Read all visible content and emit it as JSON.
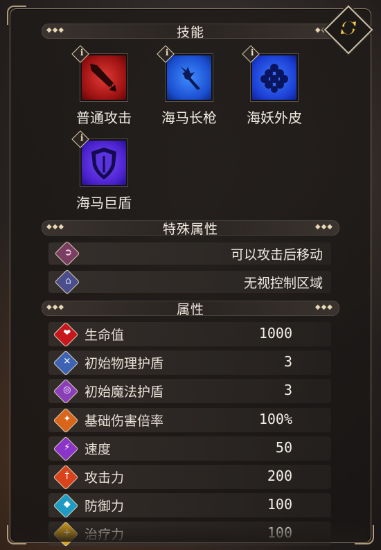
{
  "sections": {
    "skills_title": "技能",
    "special_title": "特殊属性",
    "attributes_title": "属性",
    "dots": "◆◆◆"
  },
  "skills": [
    {
      "name": "普通攻击",
      "info": "i",
      "color": "#c41f1f",
      "icon": "sword-icon"
    },
    {
      "name": "海马长枪",
      "info": "i",
      "color": "#1d5fe0",
      "icon": "trident-icon"
    },
    {
      "name": "海妖外皮",
      "info": "i",
      "color": "#2a4fe3",
      "icon": "scale-armor-icon"
    },
    {
      "name": "海马巨盾",
      "info": "i",
      "color": "#5a2fd6",
      "icon": "shield-icon"
    }
  ],
  "special": [
    {
      "text": "可以攻击后移动",
      "color": "#7a3e62",
      "icon": "move-after-attack-icon"
    },
    {
      "text": "无视控制区域",
      "color": "#4a4f8c",
      "icon": "ignore-zone-icon"
    }
  ],
  "attributes": [
    {
      "label": "生命值",
      "value": "1000",
      "color": "#c8161d",
      "icon": "heart-icon",
      "glyph": "❤"
    },
    {
      "label": "初始物理护盾",
      "value": "3",
      "color": "#3d63b5",
      "icon": "physical-shield-icon",
      "glyph": "✕"
    },
    {
      "label": "初始魔法护盾",
      "value": "3",
      "color": "#8a3fb8",
      "icon": "magic-shield-icon",
      "glyph": "◎"
    },
    {
      "label": "基础伤害倍率",
      "value": "100%",
      "color": "#d9651b",
      "icon": "damage-multiplier-icon",
      "glyph": "✦"
    },
    {
      "label": "速度",
      "value": "50",
      "color": "#8b34c9",
      "icon": "speed-icon",
      "glyph": "⚡"
    },
    {
      "label": "攻击力",
      "value": "200",
      "color": "#d8431c",
      "icon": "attack-icon",
      "glyph": "†"
    },
    {
      "label": "防御力",
      "value": "100",
      "color": "#1e9bc4",
      "icon": "defense-icon",
      "glyph": "◆"
    },
    {
      "label": "治疗力",
      "value": "100",
      "color": "#d9a21b",
      "icon": "heal-icon",
      "glyph": "+"
    }
  ]
}
